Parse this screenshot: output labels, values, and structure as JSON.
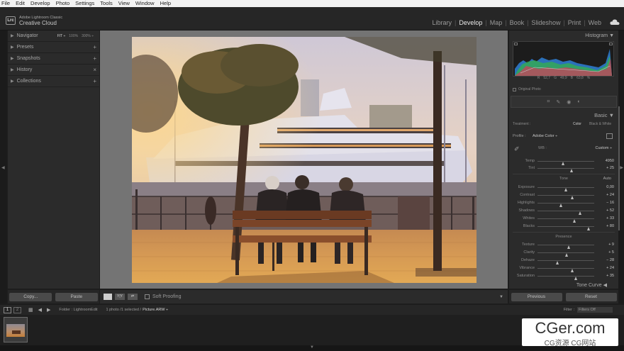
{
  "menubar": [
    "File",
    "Edit",
    "Develop",
    "Photo",
    "Settings",
    "Tools",
    "View",
    "Window",
    "Help"
  ],
  "identity": {
    "logo": "Lrc",
    "line1": "Adobe Lightroom Classic",
    "line2": "Creative Cloud"
  },
  "modules": [
    "Library",
    "Develop",
    "Map",
    "Book",
    "Slideshow",
    "Print",
    "Web"
  ],
  "active_module": "Develop",
  "left_panel": {
    "navigator": {
      "label": "Navigator",
      "zoom": [
        "FIT ÷",
        "100%",
        "300% ÷"
      ]
    },
    "sections": [
      {
        "label": "Presets",
        "action": "+"
      },
      {
        "label": "Snapshots",
        "action": "+"
      },
      {
        "label": "History",
        "action": "×"
      },
      {
        "label": "Collections",
        "action": "+"
      }
    ],
    "copy": "Copy...",
    "paste": "Paste"
  },
  "toolbar": {
    "yy": "Y|Y",
    "soft_proofing": "Soft Proofing"
  },
  "right_panel": {
    "histogram": "Histogram",
    "histo_values": [
      "R",
      "52,7",
      "G",
      "49,9",
      "B",
      "63,8",
      "%"
    ],
    "original_photo": "Original Photo",
    "basic": "Basic",
    "treatment": {
      "label": "Treatment :",
      "color": "Color",
      "bw": "Black & White"
    },
    "profile": {
      "label": "Profile :",
      "value": "Adobe Color ÷"
    },
    "wb": {
      "label": "WB :",
      "value": "Custom ÷"
    },
    "wb_sliders": [
      {
        "label": "Temp",
        "value": "4950",
        "pos": 0.45
      },
      {
        "label": "Tint",
        "value": "+ 25",
        "pos": 0.6
      }
    ],
    "tone": {
      "label": "Tone",
      "auto": "Auto"
    },
    "tone_sliders": [
      {
        "label": "Exposure",
        "value": "0,00",
        "pos": 0.5
      },
      {
        "label": "Contrast",
        "value": "+ 24",
        "pos": 0.62
      },
      {
        "label": "Highlights",
        "value": "− 16",
        "pos": 0.42
      },
      {
        "label": "Shadows",
        "value": "+ 52",
        "pos": 0.76
      },
      {
        "label": "Whites",
        "value": "+ 33",
        "pos": 0.66
      },
      {
        "label": "Blacks",
        "value": "+ 80",
        "pos": 0.9
      }
    ],
    "presence": "Presence",
    "presence_sliders": [
      {
        "label": "Texture",
        "value": "+ 9",
        "pos": 0.55
      },
      {
        "label": "Clarity",
        "value": "+ 5",
        "pos": 0.52
      },
      {
        "label": "Dehaze",
        "value": "− 28",
        "pos": 0.36
      },
      {
        "label": "Vibrance",
        "value": "+ 24",
        "pos": 0.62
      },
      {
        "label": "Saturation",
        "value": "+ 35",
        "pos": 0.68
      }
    ],
    "tone_curve": "Tone Curve",
    "previous": "Previous",
    "reset": "Reset"
  },
  "filmstrip": {
    "box1": "1",
    "box2": "2",
    "folder": "Folder : LightroomEdit",
    "count": "1 photo /1 selected /",
    "filename": "Picture.ARW ÷",
    "filter_label": "Filter :",
    "filter_value": "Filters Off"
  },
  "watermark": {
    "main": "CGer.com",
    "sub": "CG资源 CG网站"
  },
  "colors": {
    "panel": "#2b2b2b",
    "canvas": "#747474",
    "accent_text": "#e8e8e8"
  }
}
